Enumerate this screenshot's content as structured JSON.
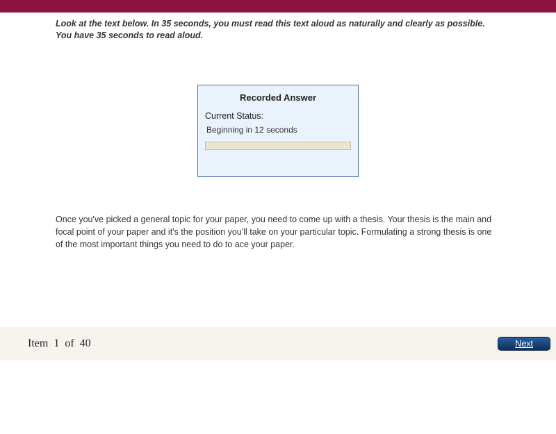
{
  "instructions": "Look at the text below. In 35 seconds, you must read this text aloud as naturally and clearly as possible. You have 35 seconds to read aloud.",
  "recorder": {
    "title": "Recorded Answer",
    "status_label": "Current Status:",
    "status_text": "Beginning in 12 seconds"
  },
  "passage": "Once you've picked a general topic for your paper, you need to come up with a thesis. Your thesis is the main and focal point of your paper and it's the position you'll take on your particular topic. Formulating a strong thesis is one of the most important things you need to do to ace your paper.",
  "footer": {
    "item_counter": "Item 1 of 40",
    "next_label": "Next"
  }
}
